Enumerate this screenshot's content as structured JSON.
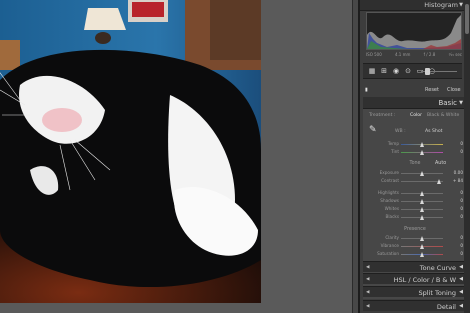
{
  "panel": {
    "histogram_title": "Histogram",
    "exif": {
      "iso": "ISO 500",
      "focal": "4.1 mm",
      "aperture": "f / 2.8",
      "shutter": "¹⁄₁₅ sec"
    },
    "reset": "Reset",
    "close": "Close",
    "basic_title": "Basic",
    "treatment_label": "Treatment :",
    "treatment_color": "Color",
    "treatment_bw": "Black & White",
    "wb_label": "WB :",
    "wb_value": "As Shot",
    "tone_label": "Tone",
    "auto_label": "Auto",
    "presence_label": "Presence"
  },
  "sliders": {
    "temp": {
      "label": "Temp",
      "value": "0",
      "position": 0.5
    },
    "tint": {
      "label": "Tint",
      "value": "0",
      "position": 0.5
    },
    "exposure": {
      "label": "Exposure",
      "value": "0.00",
      "position": 0.5
    },
    "contrast": {
      "label": "Contrast",
      "value": "+ 84",
      "position": 0.92
    },
    "highlights": {
      "label": "Highlights",
      "value": "0",
      "position": 0.5
    },
    "shadows": {
      "label": "Shadows",
      "value": "0",
      "position": 0.5
    },
    "whites": {
      "label": "Whites",
      "value": "0",
      "position": 0.5
    },
    "blacks": {
      "label": "Blacks",
      "value": "0",
      "position": 0.5
    },
    "clarity": {
      "label": "Clarity",
      "value": "0",
      "position": 0.5
    },
    "vibrance": {
      "label": "Vibrance",
      "value": "0",
      "position": 0.5
    },
    "saturation": {
      "label": "Saturation",
      "value": "0",
      "position": 0.5
    }
  },
  "collapsed_panels": {
    "tone_curve": "Tone Curve",
    "hsl": "HSL / Color / B & W",
    "split_toning": "Split Toning",
    "detail": "Detail"
  },
  "icons": [
    "triangle-right-icon",
    "triangle-left-icon",
    "eyedropper-icon",
    "crop-icon",
    "spot-removal-icon",
    "red-eye-icon",
    "graduated-filter-icon",
    "radial-filter-icon",
    "brush-icon",
    "switch-icon"
  ],
  "colors": {
    "panel_bg": "#3d3d3d",
    "header_bg": "#2f2f2f",
    "basic_bg": "#474747",
    "text": "#cfcfcf"
  }
}
